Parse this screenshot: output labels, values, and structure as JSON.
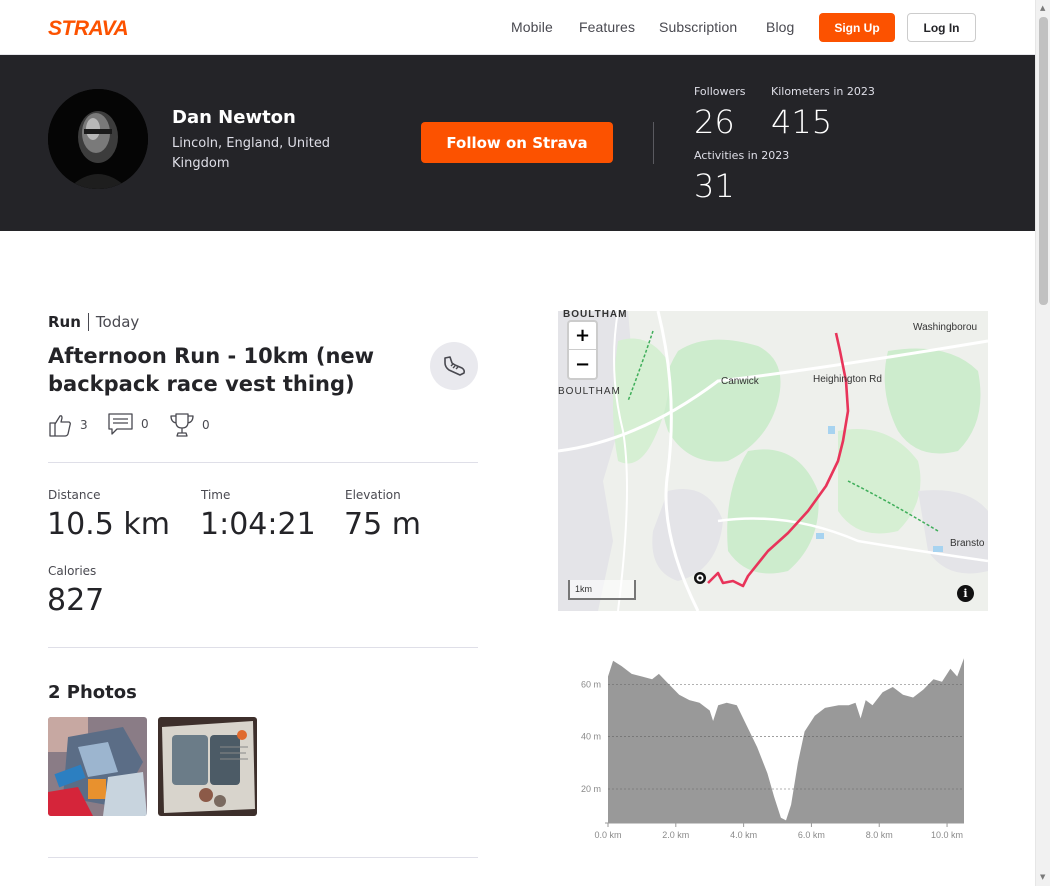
{
  "nav": {
    "logo_text": "STRAVA",
    "links": [
      "Mobile",
      "Features",
      "Subscription",
      "Blog"
    ],
    "signup_label": "Sign Up",
    "login_label": "Log In",
    "brand_color": "#fc5200"
  },
  "athlete": {
    "name": "Dan Newton",
    "location": "Lincoln, England, United Kingdom",
    "follow_label": "Follow on Strava",
    "stats": [
      {
        "label": "Followers",
        "value": "26"
      },
      {
        "label": "Kilometers in 2023",
        "value": "415"
      },
      {
        "label": "Activities in 2023",
        "value": "31"
      }
    ]
  },
  "activity": {
    "type": "Run",
    "when": "Today",
    "title": "Afternoon Run - 10km (new backpack race vest thing)",
    "kudos": "3",
    "comments": "0",
    "achievements": "0",
    "metrics": [
      {
        "label": "Distance",
        "value": "10.5 km"
      },
      {
        "label": "Time",
        "value": "1:04:21"
      },
      {
        "label": "Elevation",
        "value": "75 m"
      },
      {
        "label": "Calories",
        "value": "827"
      }
    ],
    "photos_title": "2 Photos"
  },
  "map": {
    "labels": [
      "BOULTHAM",
      "BOULTHAM",
      "Canwick",
      "Heighington Rd",
      "Washingborou",
      "Bransto"
    ],
    "scale_label": "1km",
    "zoom_in": "+",
    "zoom_out": "−",
    "info": "i",
    "route_color": "#e8345a"
  },
  "chart_data": {
    "type": "area",
    "title": "",
    "xlabel": "",
    "ylabel": "",
    "x_ticks": [
      "0.0 km",
      "2.0 km",
      "4.0 km",
      "6.0 km",
      "8.0 km",
      "10.0 km"
    ],
    "y_ticks": [
      "20 m",
      "40 m",
      "60 m"
    ],
    "xlim": [
      0,
      10.5
    ],
    "ylim": [
      7,
      72
    ],
    "x": [
      0,
      0.15,
      0.4,
      0.7,
      1.0,
      1.3,
      1.5,
      1.8,
      2.1,
      2.4,
      2.7,
      3.0,
      3.1,
      3.25,
      3.5,
      3.8,
      4.1,
      4.4,
      4.7,
      4.9,
      5.1,
      5.25,
      5.4,
      5.6,
      5.8,
      6.1,
      6.4,
      6.8,
      7.1,
      7.3,
      7.45,
      7.6,
      7.8,
      8.1,
      8.4,
      8.7,
      9.0,
      9.3,
      9.6,
      9.85,
      10.1,
      10.3,
      10.5
    ],
    "elevation": [
      63,
      69,
      67,
      64,
      63,
      62,
      64,
      60,
      56,
      54,
      53,
      50,
      46,
      52,
      53,
      52,
      44,
      36,
      26,
      17,
      9,
      8,
      14,
      30,
      42,
      48,
      51,
      52,
      52,
      53,
      47,
      54,
      52,
      57,
      59,
      56,
      55,
      58,
      62,
      61,
      66,
      63,
      70
    ],
    "fill_color": "#999999",
    "grid": true
  }
}
